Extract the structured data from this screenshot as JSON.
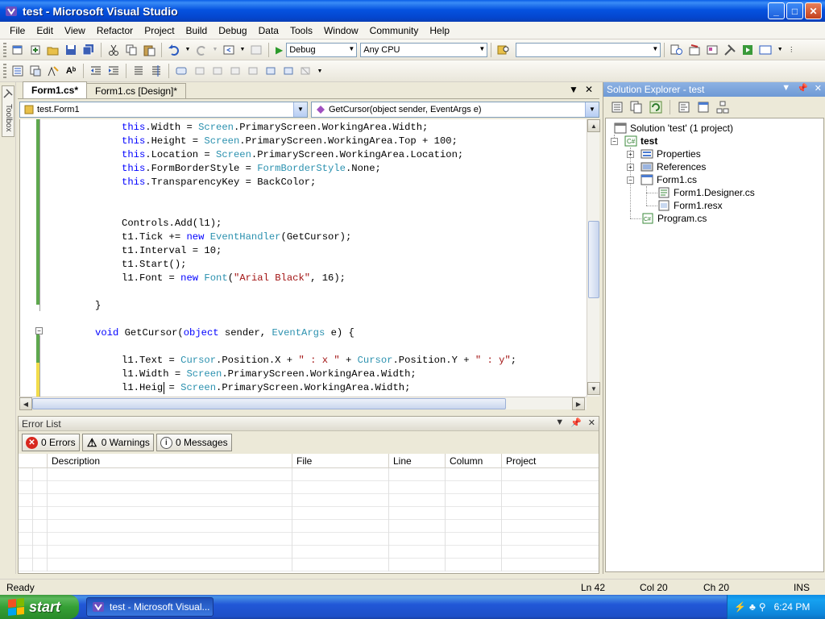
{
  "window": {
    "title": "test - Microsoft Visual Studio",
    "buttons": {
      "minimize": "_",
      "maximize": "□",
      "close": "✕"
    }
  },
  "menu": {
    "items": [
      "File",
      "Edit",
      "View",
      "Refactor",
      "Project",
      "Build",
      "Debug",
      "Data",
      "Tools",
      "Window",
      "Community",
      "Help"
    ]
  },
  "toolbar": {
    "config_value": "Debug",
    "platform_value": "Any CPU",
    "find_value": ""
  },
  "toolbox": {
    "label": "Toolbox"
  },
  "editor": {
    "tabs": [
      {
        "label": "Form1.cs*",
        "active": true
      },
      {
        "label": "Form1.cs [Design]*",
        "active": false
      }
    ],
    "class_combo": "test.Form1",
    "member_combo": "GetCursor(object sender, EventArgs e)",
    "code_lines": [
      "this.Width = Screen.PrimaryScreen.WorkingArea.Width;",
      "this.Height = Screen.PrimaryScreen.WorkingArea.Top + 100;",
      "this.Location = Screen.PrimaryScreen.WorkingArea.Location;",
      "this.FormBorderStyle = FormBorderStyle.None;",
      "this.TransparencyKey = BackColor;",
      "",
      "",
      "Controls.Add(l1);",
      "t1.Tick += new EventHandler(GetCursor);",
      "t1.Interval = 10;",
      "t1.Start();",
      "l1.Font = new Font(\"Arial Black\", 16);",
      "",
      "}",
      "",
      "void GetCursor(object sender, EventArgs e) {",
      "",
      "l1.Text = Cursor.Position.X + \" : x \" + Cursor.Position.Y + \" : y\";",
      "l1.Width = Screen.PrimaryScreen.WorkingArea.Width;",
      "l1.Heig = Screen.PrimaryScreen.WorkingArea.Width;"
    ]
  },
  "error_list": {
    "title": "Error List",
    "errors_label": "0 Errors",
    "warnings_label": "0 Warnings",
    "messages_label": "0 Messages",
    "columns": [
      "",
      "Description",
      "File",
      "Line",
      "Column",
      "Project"
    ]
  },
  "solution_explorer": {
    "title": "Solution Explorer - test",
    "nodes": {
      "solution": "Solution 'test' (1 project)",
      "project": "test",
      "properties": "Properties",
      "references": "References",
      "form1": "Form1.cs",
      "designer": "Form1.Designer.cs",
      "resx": "Form1.resx",
      "program": "Program.cs"
    }
  },
  "status": {
    "ready": "Ready",
    "ln": "Ln 42",
    "col": "Col 20",
    "ch": "Ch 20",
    "mode": "INS"
  },
  "taskbar": {
    "start_label": "start",
    "task_label": "test - Microsoft Visual...",
    "clock": "6:24 PM"
  },
  "colors": {
    "keyword": "#0000ff",
    "type": "#2b91af",
    "string": "#a31515",
    "titlebar": "#0553e0"
  }
}
